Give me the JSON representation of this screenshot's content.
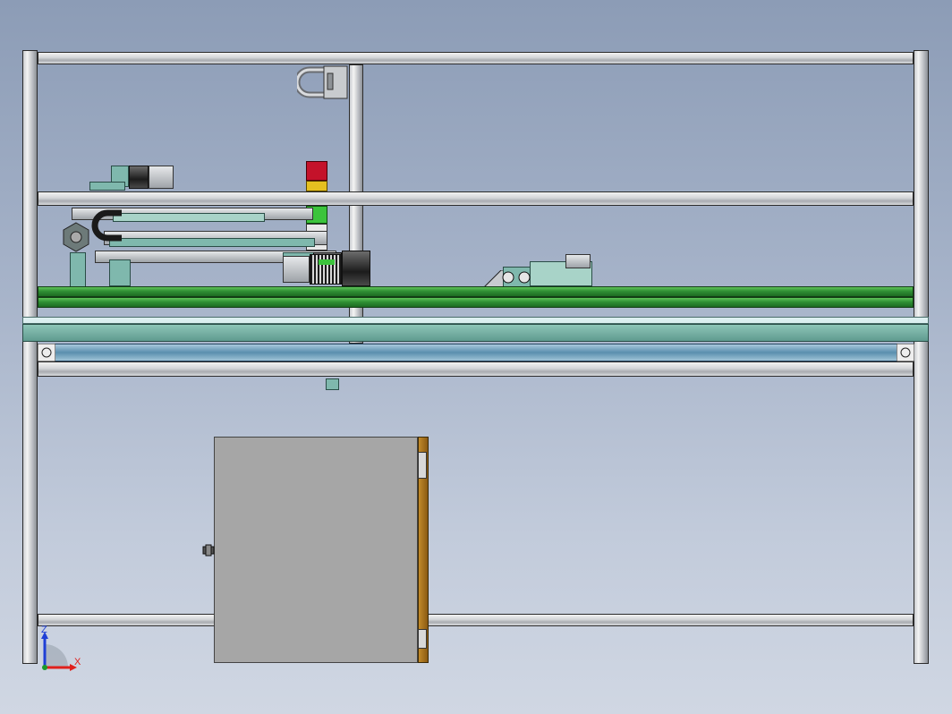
{
  "triad": {
    "z_label": "Z",
    "x_label": "X",
    "colors": {
      "z": "#1f3fd6",
      "x": "#e0201c",
      "y": "#1a9a2a"
    }
  },
  "colors": {
    "background_top": "#8c9cb6",
    "background_bottom": "#d0d7e3",
    "frame": "#d3d5d8",
    "conveyor": "#2f8f34",
    "mount": "#7fb8ad",
    "cabinet": "#a6a6a6",
    "cabinet_edge": "#b07a20",
    "beacon_red": "#c4122a",
    "beacon_yellow": "#e5c020",
    "beacon_green": "#3cc43c"
  },
  "icons": [
    "machine-frame-model",
    "coordinate-triad-icon"
  ]
}
